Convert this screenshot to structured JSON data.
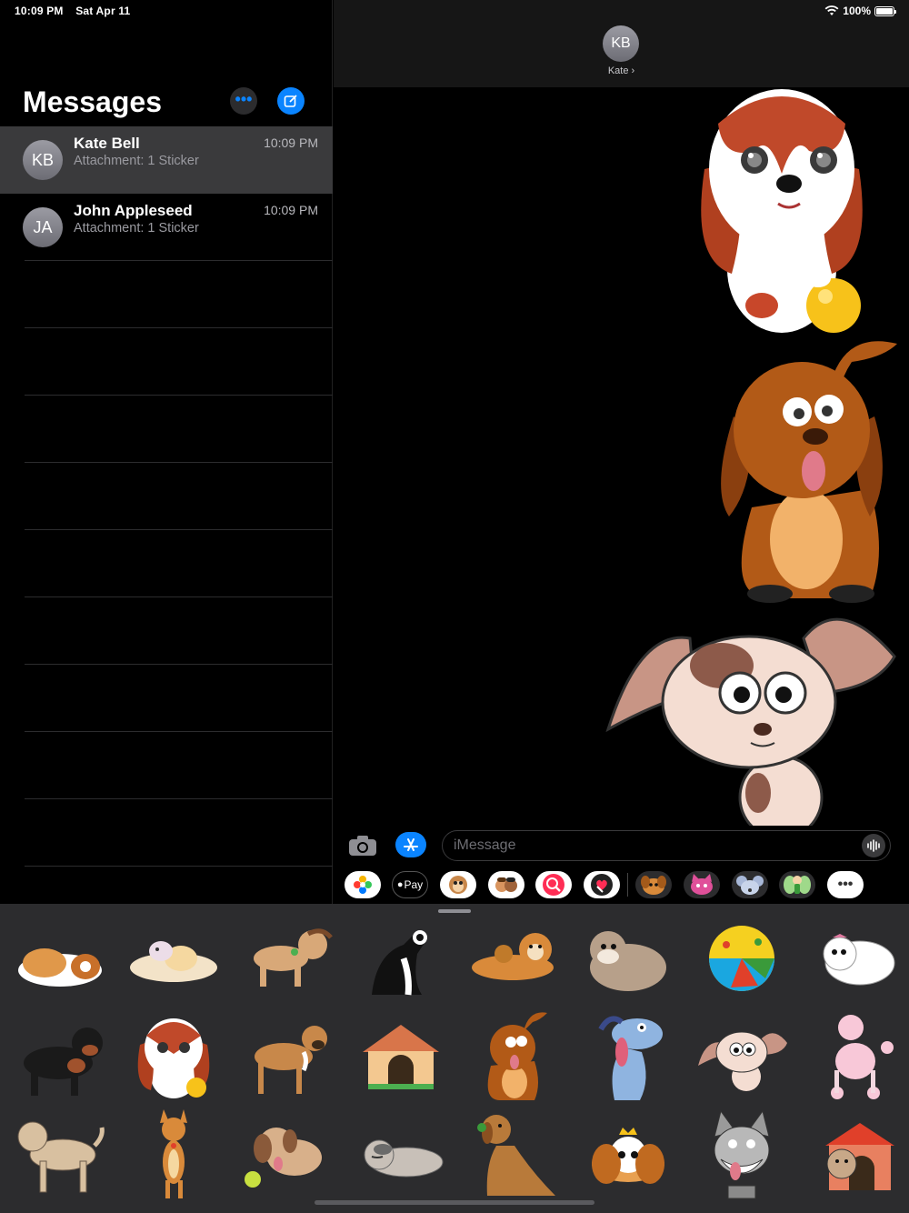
{
  "status_bar": {
    "time": "10:09 PM",
    "date": "Sat Apr 11",
    "battery": "100%"
  },
  "sidebar": {
    "title": "Messages",
    "more_label": "•••",
    "conversations": [
      {
        "initials": "KB",
        "name": "Kate Bell",
        "time": "10:09 PM",
        "preview": "Attachment: 1 Sticker",
        "selected": true
      },
      {
        "initials": "JA",
        "name": "John Appleseed",
        "time": "10:09 PM",
        "preview": "Attachment: 1 Sticker",
        "selected": false
      }
    ]
  },
  "chat_header": {
    "initials": "KB",
    "name": "Kate ›"
  },
  "input": {
    "placeholder": "iMessage"
  },
  "app_strip": {
    "icons": [
      "photos-icon",
      "apple-pay-icon",
      "animoji-icon",
      "memoji-icon",
      "search-web-icon",
      "digital-touch-icon",
      "dog-sticker-app-icon",
      "cat-sticker-app-icon",
      "mouse-sticker-app-icon",
      "fairy-sticker-app-icon",
      "more-apps-icon"
    ],
    "apple_pay_label": "Pay",
    "more_label": "•••"
  },
  "colors": {
    "accent": "#0a84ff",
    "drawer_bg": "#2c2c2e",
    "selected_row": "#3a3a3c"
  }
}
